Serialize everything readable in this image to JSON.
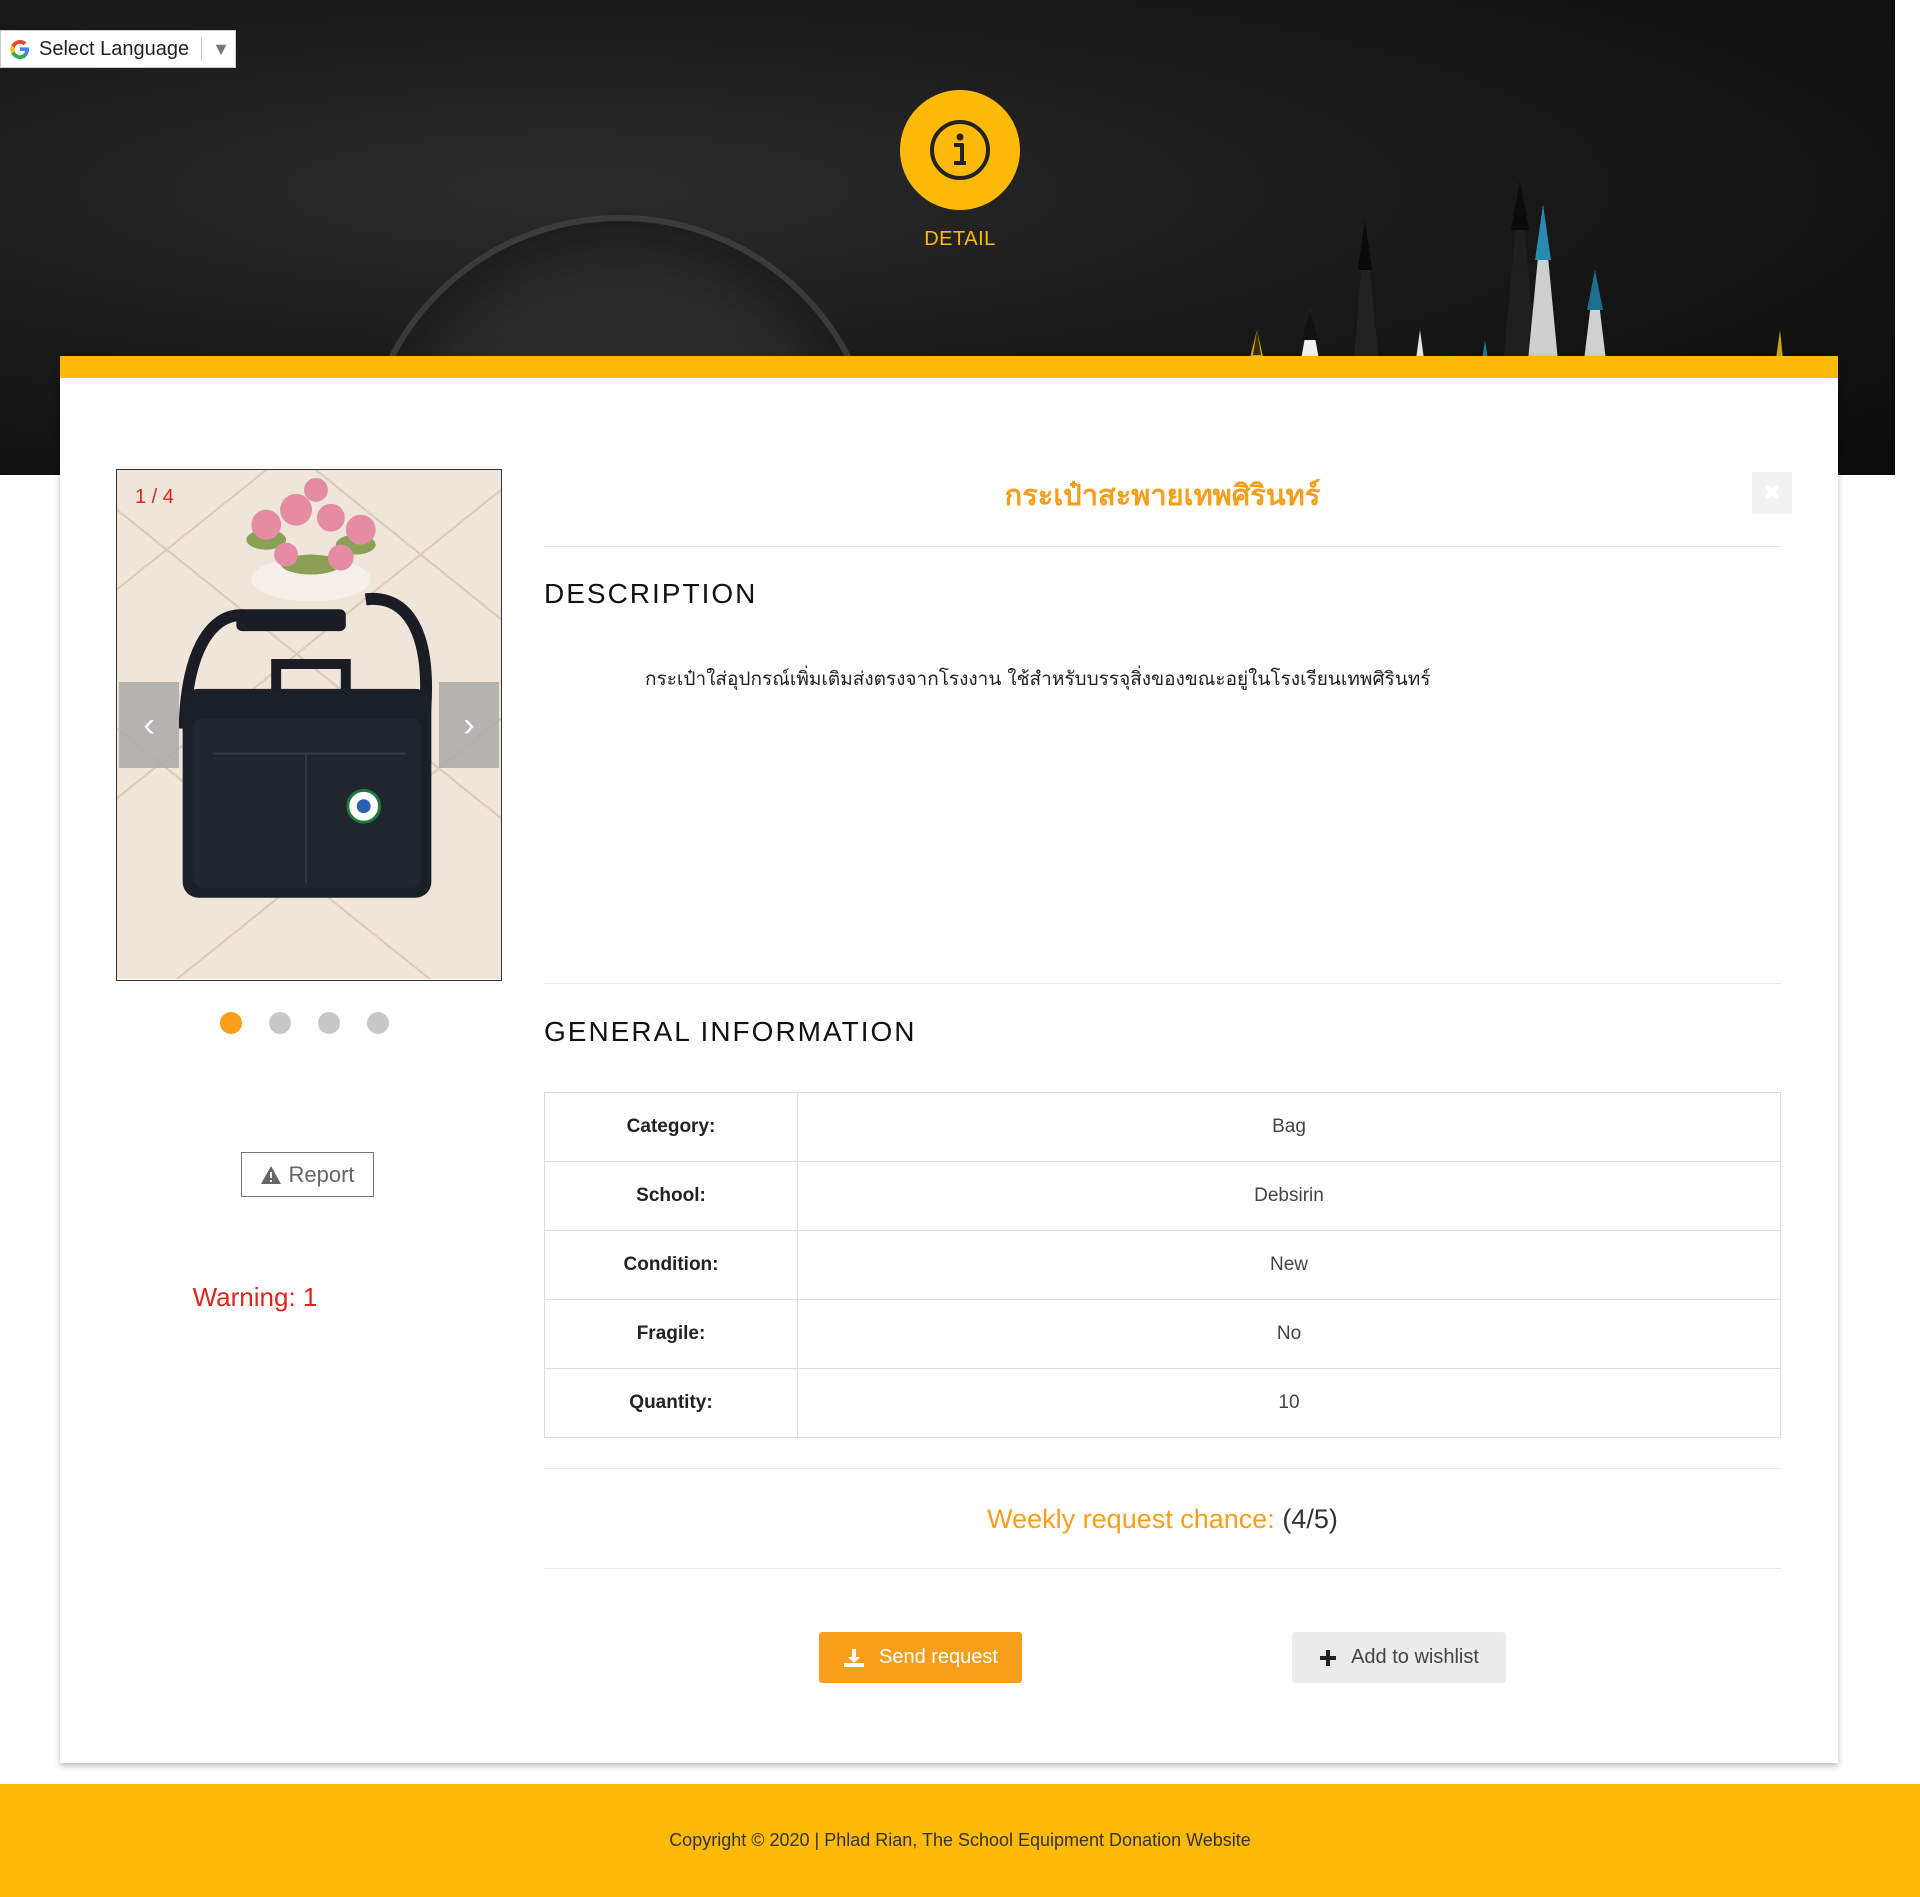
{
  "language_selector": {
    "label": "Select Language",
    "arrow": "▼"
  },
  "header": {
    "icon": "info-icon",
    "label": "DETAIL"
  },
  "item": {
    "title": "กระเป๋าสะพายเทพศิรินทร์",
    "close_icon": "close-icon"
  },
  "carousel": {
    "counter": "1 / 4",
    "prev": "‹",
    "next": "›",
    "slides_total": 4,
    "active_slide": 1
  },
  "report": {
    "label": "Report"
  },
  "warning": {
    "text": "Warning: 1"
  },
  "description": {
    "heading": "DESCRIPTION",
    "text": "กระเป๋าใส่อุปกรณ์เพิ่มเติมส่งตรงจากโรงงาน ใช้สำหรับบรรจุสิ่งของขณะอยู่ในโรงเรียนเทพศิรินทร์"
  },
  "general_info": {
    "heading": "GENERAL INFORMATION",
    "rows": [
      {
        "key": "Category:",
        "value": "Bag"
      },
      {
        "key": "School:",
        "value": "Debsirin"
      },
      {
        "key": "Condition:",
        "value": "New"
      },
      {
        "key": "Fragile:",
        "value": "No"
      },
      {
        "key": "Quantity:",
        "value": "10"
      }
    ]
  },
  "weekly_chance": {
    "label": "Weekly request chance:",
    "value": "(4/5)"
  },
  "actions": {
    "send": "Send request",
    "wishlist": "Add to wishlist"
  },
  "footer": {
    "text": "Copyright © 2020 | Phlad Rian, The School Equipment Donation Website"
  },
  "colors": {
    "accent": "#FFBA08",
    "orange": "#F79E1B",
    "warning": "#e0241b"
  }
}
